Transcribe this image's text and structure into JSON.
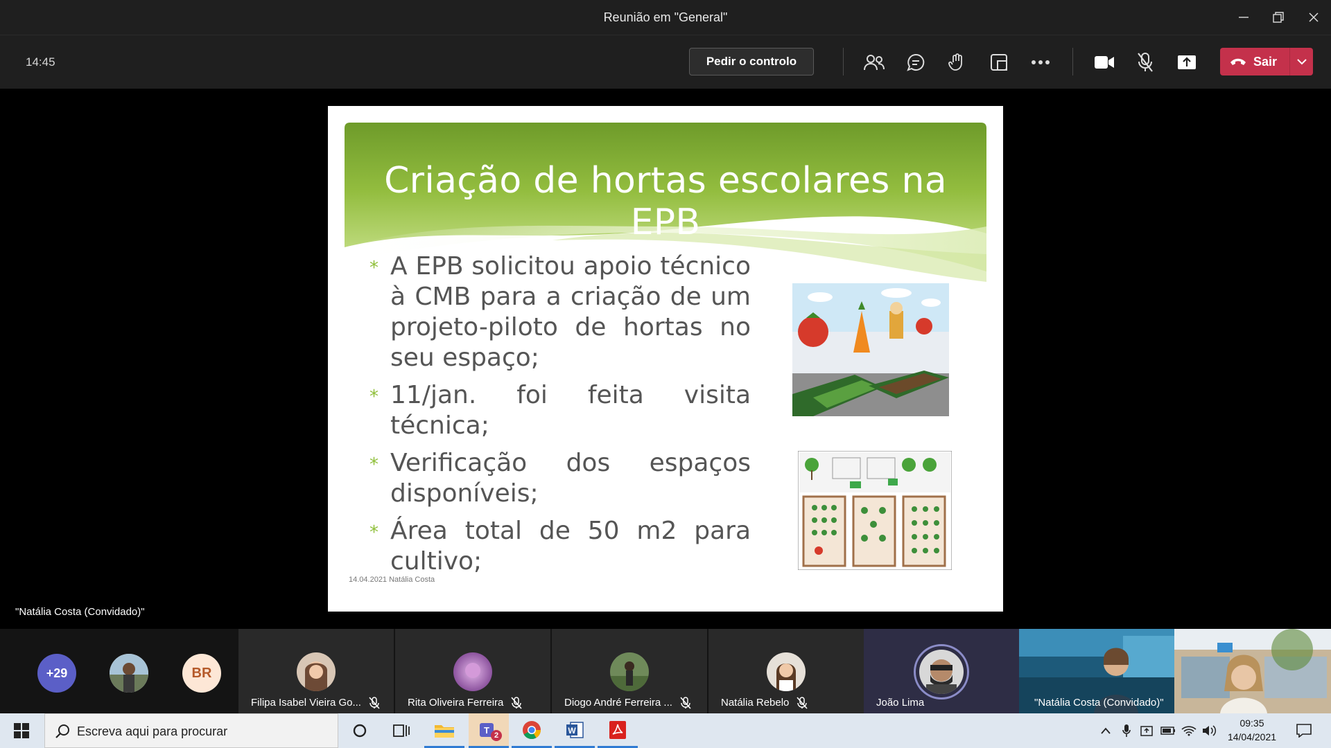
{
  "window": {
    "title": "Reunião em \"General\""
  },
  "toolbar": {
    "clock": "14:45",
    "request_control_label": "Pedir o controlo",
    "leave_label": "Sair",
    "leave_color": "#c4314b"
  },
  "slide": {
    "title": "Criação de hortas escolares na EPB",
    "bullets": [
      "A EPB solicitou apoio técnico à CMB para a criação de um projeto-piloto de hortas no seu espaço;",
      "11/jan. foi feita visita técnica;",
      "Verificação dos espaços disponíveis;",
      "Área total de 50 m2 para cultivo;"
    ],
    "bullet_glyph": "*",
    "footer": "14.04.2021 Natália Costa",
    "accent_color": "#8fbf3a"
  },
  "stage": {
    "presenter_label": "\"Natália Costa (Convidado)\""
  },
  "participants": {
    "overflow_count": "+29",
    "initials": "BR",
    "tiles": [
      {
        "name": "Filipa Isabel Vieira Go...",
        "muted": true
      },
      {
        "name": "Rita Oliveira Ferreira",
        "muted": true
      },
      {
        "name": "Diogo André Ferreira ...",
        "muted": true
      },
      {
        "name": "Natália Rebelo",
        "muted": true
      },
      {
        "name": "João Lima",
        "muted": false
      }
    ],
    "video_tiles": [
      {
        "name": "\"Natália Costa (Convidado)\""
      }
    ]
  },
  "taskbar": {
    "search_placeholder": "Escreva aqui para procurar",
    "teams_badge": "2",
    "time": "09:35",
    "date": "14/04/2021"
  }
}
